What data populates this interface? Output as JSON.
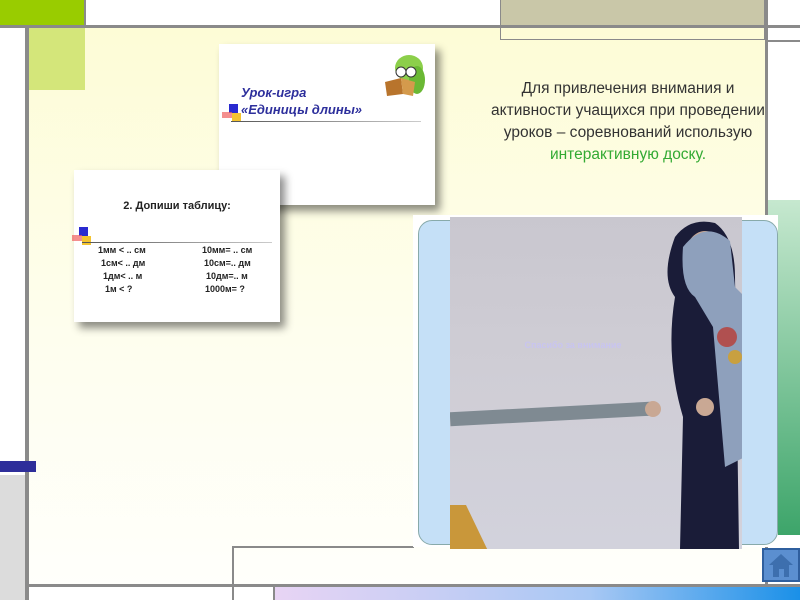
{
  "slide_thumb_1": {
    "title_line1": "Урок-игра",
    "title_line2": "«Единицы длины»"
  },
  "slide_thumb_2": {
    "title": "2. Допиши таблицу:",
    "left_column": [
      "1мм  < .. см",
      "1см< .. дм",
      "1дм< .. м",
      "1м < ?"
    ],
    "right_column": [
      "10мм= .. см",
      "10см=.. дм",
      "10дм=.. м",
      "1000м= ?"
    ]
  },
  "main_text": {
    "plain": "Для привлечения внимания и активности учащихся при проведении уроков – соревнований использую",
    "highlight": "интерактивную доску."
  },
  "photo": {
    "board_text": "Спасибо за внимание"
  },
  "colors": {
    "frame": "#8a8a8a",
    "accent_green": "#99cc00",
    "highlight_text": "#33aa33",
    "title_blue": "#2d2f9c"
  },
  "nav": {
    "home_icon": "home-icon"
  }
}
